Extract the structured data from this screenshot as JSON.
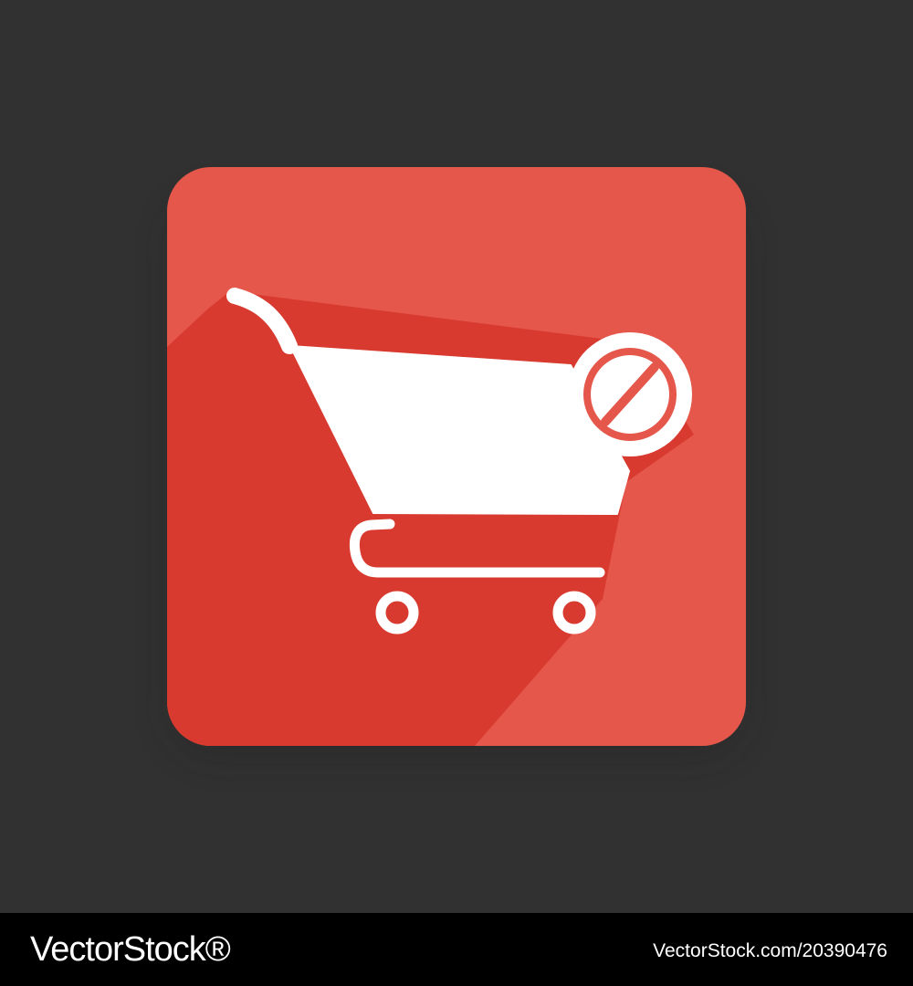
{
  "colors": {
    "background": "#313131",
    "tile": "#e5574b",
    "tile_long_shadow": "#d83a2f",
    "glyph": "#ffffff",
    "footer": "#000000",
    "footer_text": "#ffffff"
  },
  "icons": {
    "main": "shopping-cart-icon",
    "badge": "prohibited-icon"
  },
  "footer": {
    "brand": "VectorStock®",
    "image_id": "VectorStock.com/20390476"
  }
}
